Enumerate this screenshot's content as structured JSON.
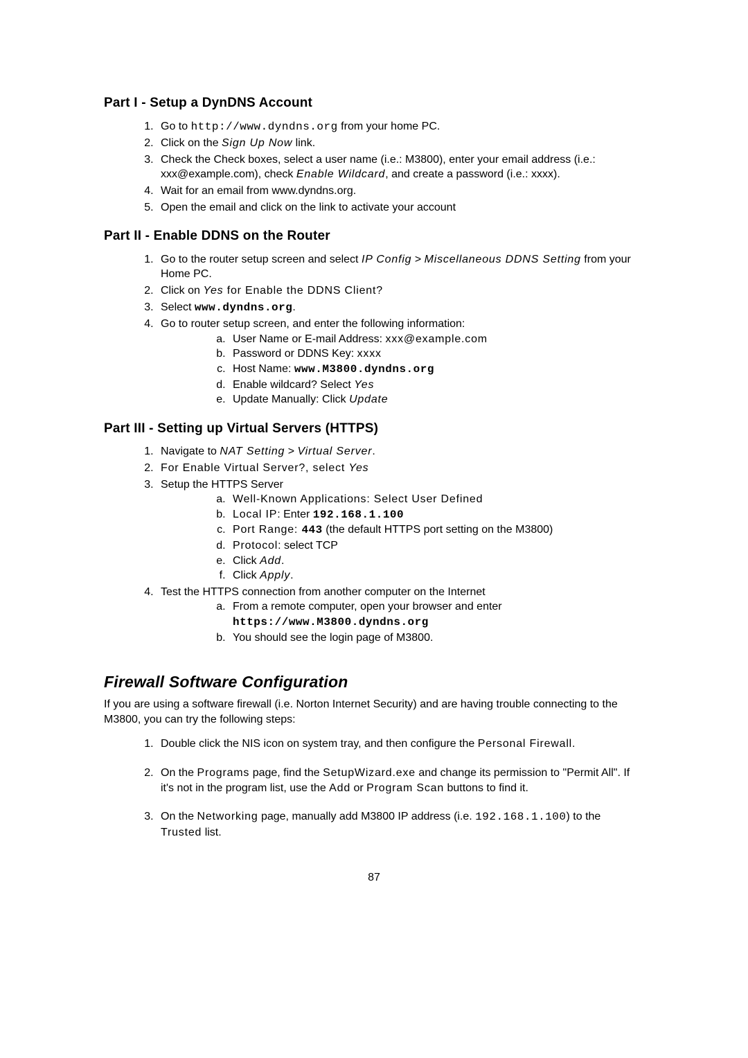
{
  "part1": {
    "heading": "Part I - Setup a DynDNS Account",
    "items": {
      "i1": {
        "pre": "Go to ",
        "url": "http://www.dyndns.org",
        "post": " from your home PC."
      },
      "i2": {
        "pre": "Click on the ",
        "link": "Sign Up Now",
        "post": " link."
      },
      "i3": {
        "a": "Check the Check boxes, select a user name (i.e.: M3800), enter your email address (i.e.: xxx@example.com), check ",
        "b": "Enable Wildcard",
        "c": ", and create a password (i.e.: xxxx)."
      },
      "i4": "Wait for an email from www.dyndns.org.",
      "i5": "Open the email and click on the link to activate your account"
    }
  },
  "part2": {
    "heading": "Part II - Enable DDNS on the Router",
    "items": {
      "i1": {
        "a": "Go to the router setup screen and select ",
        "b": "IP Config",
        "c": " > ",
        "d": "Miscellaneous DDNS Setting",
        "e": " from your Home PC."
      },
      "i2": {
        "a": "Click on ",
        "b": "Yes",
        "c": " for Enable the DDNS Client?"
      },
      "i3": {
        "a": "Select ",
        "b": "www.dyndns.org",
        "c": "."
      },
      "i4": "Go to router setup screen, and enter the following information:",
      "sub": {
        "a": {
          "a": "User Name or E-mail Address: ",
          "b": "xxx@example.com"
        },
        "b": {
          "a": "Password or DDNS Key: ",
          "b": "xxxx"
        },
        "c": {
          "a": "Host Name: ",
          "b": "www.M3800.dyndns.org"
        },
        "d": {
          "a": "Enable wildcard? Select ",
          "b": "Yes"
        },
        "e": {
          "a": "Update Manually: Click ",
          "b": "Update"
        }
      }
    }
  },
  "part3": {
    "heading": "Part III - Setting up Virtual Servers (HTTPS)",
    "items": {
      "i1": {
        "a": "Navigate to ",
        "b": "NAT Setting",
        "c": " > ",
        "d": "Virtual Server",
        "e": "."
      },
      "i2": {
        "a": "For Enable Virtual Server?, select ",
        "b": "Yes"
      },
      "i3": "Setup the HTTPS Server",
      "sub3": {
        "a": {
          "a": "Well-Known Applications",
          "b": ": Select User Defined"
        },
        "b": {
          "a": "Local IP",
          "b": ": Enter ",
          "c": "192.168.1.100"
        },
        "c": {
          "a": "Port Range: ",
          "b": "443",
          "c": " (the default HTTPS port setting on the M3800)"
        },
        "d": {
          "a": "Protocol",
          "b": ": select TCP"
        },
        "e": {
          "a": "Click ",
          "b": "Add",
          "c": "."
        },
        "f": {
          "a": "Click ",
          "b": "Apply",
          "c": "."
        }
      },
      "i4": "Test the HTTPS connection from another computer on the Internet",
      "sub4": {
        "a": {
          "a": "From a remote computer, open your browser and enter ",
          "b": "https://www.M3800.dyndns.org"
        },
        "b": "You should see the login page of M3800."
      }
    }
  },
  "firewall": {
    "heading": "Firewall Software Configuration",
    "intro": "If you are using a software firewall (i.e. Norton Internet Security) and are having trouble connecting to the M3800, you can try the following steps:",
    "items": {
      "i1": {
        "a": "Double click the NIS icon on system tray, and then configure the ",
        "b": "Personal Firewall",
        "c": "."
      },
      "i2": {
        "a": "On the ",
        "b": "Programs",
        "c": " page, find the ",
        "d": "SetupWizard.exe",
        "e": " and change its permission to \"Permit All\". If it's not in the program list, use the ",
        "f": "Add",
        "g": " or ",
        "h": "Program Scan",
        "i": " buttons to find it."
      },
      "i3": {
        "a": "On the ",
        "b": "Networking",
        "c": " page, manually add M3800 IP address (i.e. ",
        "d": "192.168.1.100",
        "e": ") to the ",
        "f": "Trusted",
        "g": " list."
      }
    }
  },
  "pageno": "87"
}
